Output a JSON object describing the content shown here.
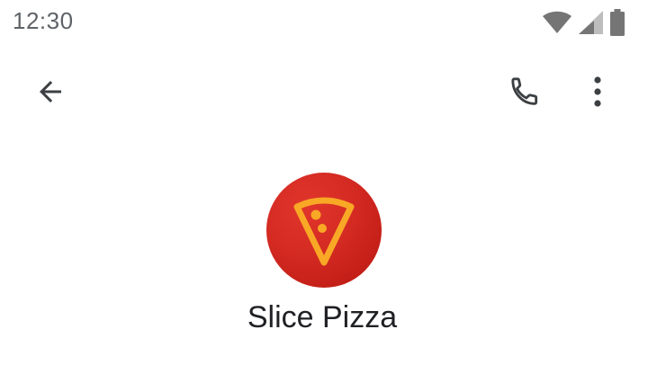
{
  "status_bar": {
    "time": "12:30",
    "icons": [
      "wifi-icon",
      "cellular-signal-icon",
      "battery-icon"
    ]
  },
  "app_bar": {
    "back_icon": "arrow-back-icon",
    "call_icon": "phone-icon",
    "more_icon": "more-vert-icon"
  },
  "business": {
    "name": "Slice Pizza",
    "logo_icon": "pizza-slice-icon",
    "logo_bg_color": "#d32a22",
    "logo_fg_color": "#f9a825"
  }
}
